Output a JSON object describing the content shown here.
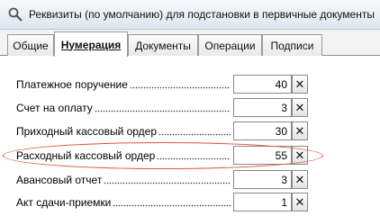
{
  "window": {
    "title": "Реквизиты (по умолчанию) для подстановки в первичные документы",
    "icon": "search-icon"
  },
  "tabs": [
    {
      "label": "Общие",
      "active": false
    },
    {
      "label": "Нумерация",
      "active": true
    },
    {
      "label": "Документы",
      "active": false
    },
    {
      "label": "Операции",
      "active": false
    },
    {
      "label": "Подписи",
      "active": false
    }
  ],
  "rows": [
    {
      "label": "Платежное поручение",
      "value": "40"
    },
    {
      "label": "Счет на оплату",
      "value": "3"
    },
    {
      "label": "Приходный кассовый ордер",
      "value": "30"
    },
    {
      "label": "Расходный кассовый ордер",
      "value": "55"
    },
    {
      "label": "Авансовый отчет",
      "value": "3"
    },
    {
      "label": "Акт сдачи-приемки",
      "value": "1"
    }
  ],
  "clear_button_label": "✕",
  "highlight_color": "#d9543a"
}
